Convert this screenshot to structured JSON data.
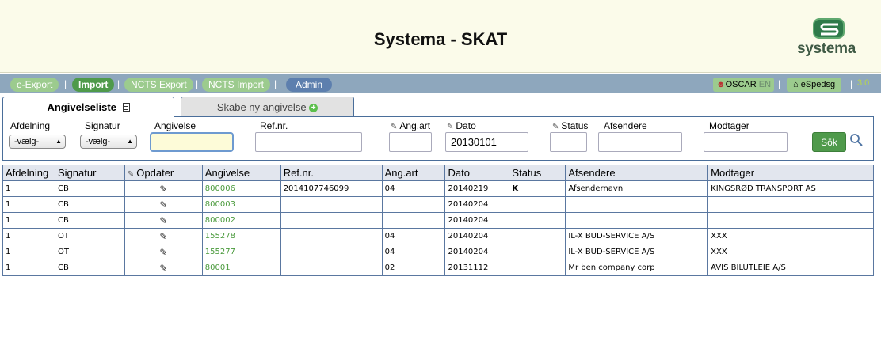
{
  "header": {
    "title": "Systema - SKAT",
    "logo_text": "systema"
  },
  "nav": {
    "items": [
      {
        "label": "e-Export"
      },
      {
        "label": "Import"
      },
      {
        "label": "NCTS Export"
      },
      {
        "label": "NCTS Import"
      },
      {
        "label": "Admin"
      }
    ],
    "separator": "|",
    "user": "OSCAR",
    "lang": "EN",
    "espedsg": "eSpedsg",
    "version": "3.0"
  },
  "tabs": [
    {
      "label": "Angivelseliste"
    },
    {
      "label": "Skabe ny angivelse"
    }
  ],
  "filter": {
    "afdelning_label": "Afdelning",
    "signatur_label": "Signatur",
    "angivelse_label": "Angivelse",
    "refnr_label": "Ref.nr.",
    "angart_label": "Ang.art",
    "dato_label": "Dato",
    "status_label": "Status",
    "afsendere_label": "Afsendere",
    "modtager_label": "Modtager",
    "afdelning_value": "-vælg-",
    "signatur_value": "-vælg-",
    "angivelse_value": "",
    "refnr_value": "",
    "angart_value": "",
    "dato_value": "20130101",
    "status_value": "",
    "afsendere_value": "",
    "modtager_value": "",
    "search_label": "Sök"
  },
  "table": {
    "columns": [
      "Afdelning",
      "Signatur",
      "Opdater",
      "Angivelse",
      "Ref.nr.",
      "Ang.art",
      "Dato",
      "Status",
      "Afsendere",
      "Modtager"
    ],
    "rows": [
      {
        "afdelning": "1",
        "signatur": "CB",
        "angivelse": "800006",
        "refnr": "2014107746099",
        "angart": "04",
        "dato": "20140219",
        "status": "K",
        "afsendere": "Afsendernavn",
        "modtager": "KINGSRØD TRANSPORT AS"
      },
      {
        "afdelning": "1",
        "signatur": "CB",
        "angivelse": "800003",
        "refnr": "",
        "angart": "",
        "dato": "20140204",
        "status": "",
        "afsendere": "",
        "modtager": ""
      },
      {
        "afdelning": "1",
        "signatur": "CB",
        "angivelse": "800002",
        "refnr": "",
        "angart": "",
        "dato": "20140204",
        "status": "",
        "afsendere": "",
        "modtager": ""
      },
      {
        "afdelning": "1",
        "signatur": "OT",
        "angivelse": "155278",
        "refnr": "",
        "angart": "04",
        "dato": "20140204",
        "status": "",
        "afsendere": "IL-X BUD-SERVICE A/S",
        "modtager": "XXX"
      },
      {
        "afdelning": "1",
        "signatur": "OT",
        "angivelse": "155277",
        "refnr": "",
        "angart": "04",
        "dato": "20140204",
        "status": "",
        "afsendere": "IL-X BUD-SERVICE A/S",
        "modtager": "XXX"
      },
      {
        "afdelning": "1",
        "signatur": "CB",
        "angivelse": "80001",
        "refnr": "",
        "angart": "02",
        "dato": "20131112",
        "status": "",
        "afsendere": "Mr ben company corp",
        "modtager": "AVIS BILUTLEIE A/S"
      }
    ]
  },
  "colors": {
    "header_bg": "#fbfbea",
    "nav_bg": "#8ea7bd",
    "accent_green": "#4f9a4b",
    "link_green": "#4a9a3c"
  }
}
